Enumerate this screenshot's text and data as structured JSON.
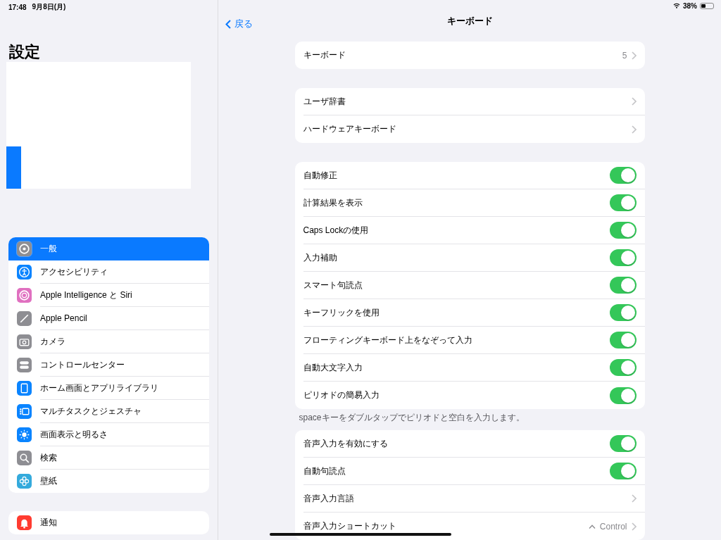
{
  "status_bar": {
    "time": "17:48",
    "date": "9月8日(月)",
    "battery": "38%"
  },
  "sidebar": {
    "title": "設定",
    "groups": [
      {
        "items": [
          {
            "label": "一般",
            "kind": "gear",
            "selected": true
          },
          {
            "label": "アクセシビリティ",
            "kind": "accessibility",
            "selected": false
          },
          {
            "label": "Apple Intelligence と Siri",
            "kind": "siri",
            "selected": false
          },
          {
            "label": "Apple Pencil",
            "kind": "pencil",
            "selected": false
          },
          {
            "label": "カメラ",
            "kind": "camera",
            "selected": false
          },
          {
            "label": "コントロールセンター",
            "kind": "switches",
            "selected": false
          },
          {
            "label": "ホーム画面とアプリライブラリ",
            "kind": "homescreen",
            "selected": false
          },
          {
            "label": "マルチタスクとジェスチャ",
            "kind": "multitask",
            "selected": false
          },
          {
            "label": "画面表示と明るさ",
            "kind": "brightness",
            "selected": false
          },
          {
            "label": "検索",
            "kind": "search",
            "selected": false
          },
          {
            "label": "壁紙",
            "kind": "wallpaper",
            "selected": false
          }
        ]
      },
      {
        "items": [
          {
            "label": "通知",
            "kind": "bell",
            "selected": false
          }
        ]
      }
    ]
  },
  "nav": {
    "back": "戻る",
    "title": "キーボード"
  },
  "groups": [
    {
      "rows": [
        {
          "kind": "link",
          "label": "キーボード",
          "value": "5"
        }
      ]
    },
    {
      "rows": [
        {
          "kind": "link",
          "label": "ユーザ辞書"
        },
        {
          "kind": "link",
          "label": "ハードウェアキーボード"
        }
      ]
    },
    {
      "rows": [
        {
          "kind": "toggle",
          "label": "自動修正",
          "on": true
        },
        {
          "kind": "toggle",
          "label": "計算結果を表示",
          "on": true
        },
        {
          "kind": "toggle",
          "label": "Caps Lockの使用",
          "on": true
        },
        {
          "kind": "toggle",
          "label": "入力補助",
          "on": true
        },
        {
          "kind": "toggle",
          "label": "スマート句読点",
          "on": true
        },
        {
          "kind": "toggle",
          "label": "キーフリックを使用",
          "on": true
        },
        {
          "kind": "toggle",
          "label": "フローティングキーボード上をなぞって入力",
          "on": true
        },
        {
          "kind": "toggle",
          "label": "自動大文字入力",
          "on": true
        },
        {
          "kind": "toggle",
          "label": "ピリオドの簡易入力",
          "on": true
        }
      ],
      "footer": "spaceキーをダブルタップでピリオドと空白を入力します。"
    },
    {
      "rows": [
        {
          "kind": "toggle",
          "label": "音声入力を有効にする",
          "on": true
        },
        {
          "kind": "toggle",
          "label": "自動句読点",
          "on": true
        },
        {
          "kind": "link",
          "label": "音声入力言語"
        },
        {
          "kind": "shortcut",
          "label": "音声入力ショートカット",
          "value": "Control"
        }
      ]
    }
  ]
}
